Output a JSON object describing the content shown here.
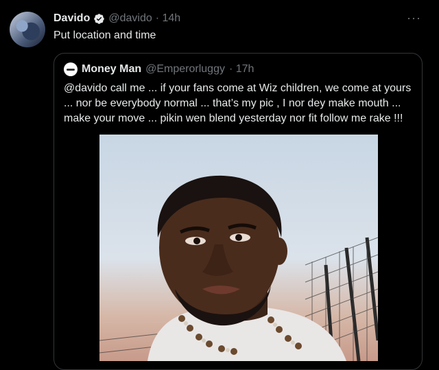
{
  "tweet": {
    "name": "Davido",
    "handle": "@davido",
    "time": "· 14h",
    "text": "Put location and time",
    "more": "···"
  },
  "quote": {
    "name": "Money Man",
    "handle": "@Emperorluggy",
    "time": "· 17h",
    "text": "@davido call me ... if your fans come at Wiz children, we come at yours ... nor be everybody normal ... that’s my pic , I nor dey make mouth ... make your move ... pikin wen blend yesterday nor fit follow me rake !!!"
  },
  "colors": {
    "verified": "#1d9bf0",
    "muted": "#71767b",
    "border": "#333639"
  },
  "icons": {
    "verified": "verified-badge-icon",
    "more": "more-options-icon"
  }
}
